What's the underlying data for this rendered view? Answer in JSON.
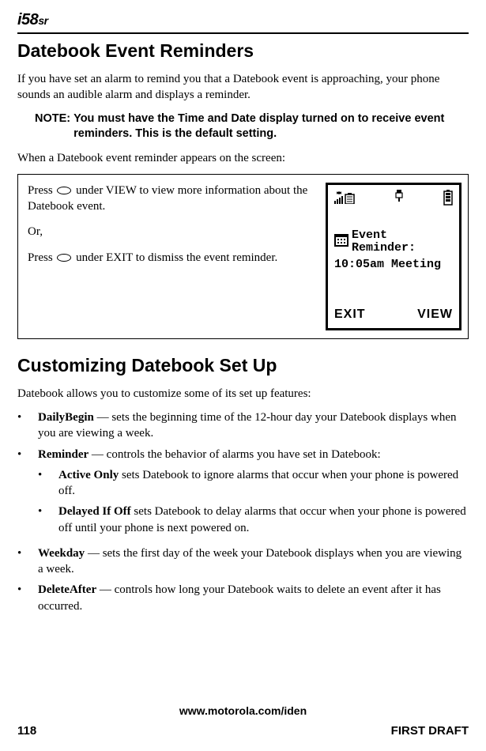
{
  "logo_main": "i58",
  "logo_suffix": "sr",
  "heading1": "Datebook Event Reminders",
  "intro_p": "If you have set an alarm to remind you that a Datebook event is approaching, your phone sounds an audible alarm and displays a reminder.",
  "note_label": "NOTE:",
  "note_text": "You must have the Time and Date display turned on to receive event reminders. This is the default setting.",
  "when_p": "When a Datebook event reminder appears on the screen:",
  "box_press1_pre": "Press ",
  "box_press1_post": " under VIEW to view more information about the Datebook event.",
  "box_or": "Or,",
  "box_press2_pre": "Press ",
  "box_press2_post": " under EXIT to dismiss the event reminder.",
  "screen_event_label": "Event Reminder:",
  "screen_event_time": "10:05am Meeting",
  "screen_softkey_left": "EXIT",
  "screen_softkey_right": "VIEW",
  "heading2": "Customizing Datebook Set Up",
  "intro2_p": "Datebook allows you to customize some of its set up features:",
  "item1_name": "DailyBegin",
  "item1_text": " — sets the beginning time of the 12-hour day your Datebook displays when you are viewing a week.",
  "item2_name": "Reminder",
  "item2_text": " — controls the behavior of alarms you have set in Datebook:",
  "item2a_name": "Active Only",
  "item2a_text": " sets Datebook to ignore alarms that occur when your phone is powered off.",
  "item2b_name": "Delayed If Off",
  "item2b_text": " sets Datebook to delay alarms that occur when your phone is powered off until your phone is next powered on.",
  "item3_name": "Weekday",
  "item3_text": " — sets the first day of the week your Datebook displays when you are viewing a week.",
  "item4_name": "DeleteAfter",
  "item4_text": " — controls how long your Datebook waits to delete an event after it has occurred.",
  "footer_url": "www.motorola.com/iden",
  "page_number": "118",
  "draft_label": "FIRST DRAFT"
}
